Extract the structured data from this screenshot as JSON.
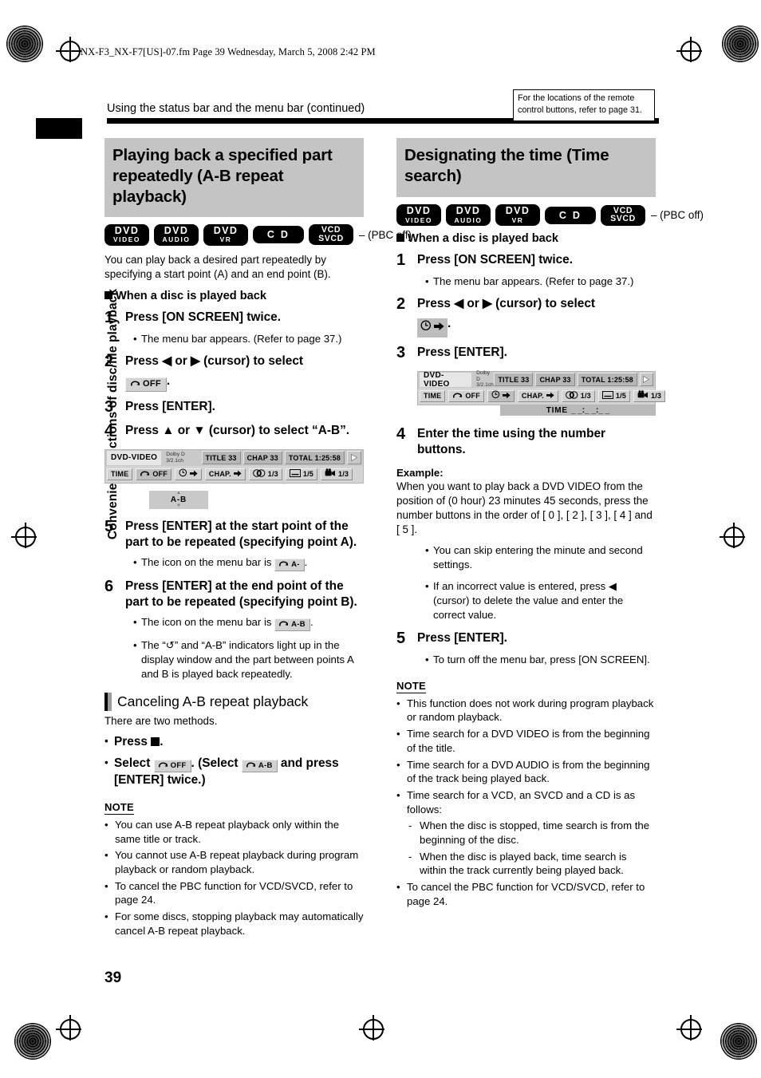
{
  "print_meta": {
    "filename_line": "NX-F3_NX-F7[US]-07.fm  Page 39  Wednesday, March 5, 2008  2:42 PM"
  },
  "side_tab": {
    "label": "Convenient functions of disc/file playback"
  },
  "running_head": {
    "title": "Using the status bar and the menu bar (continued)"
  },
  "remote_note": {
    "text": "For the locations of the remote control buttons, refer to page 31."
  },
  "page_number": "39",
  "disc_badges": [
    {
      "line1": "DVD",
      "line2": "VIDEO"
    },
    {
      "line1": "DVD",
      "line2": "AUDIO"
    },
    {
      "line1": "DVD",
      "line2": "VR"
    },
    {
      "line1": "C D",
      "line2": ""
    },
    {
      "line1": "VCD",
      "line2": "SVCD"
    }
  ],
  "pbc_note": "– (PBC off)",
  "left_column": {
    "title": "Playing back a specified part repeatedly (A-B repeat playback)",
    "intro": "You can play back a desired part repeatedly by specifying a start point (A) and an end point (B).",
    "subhead": "When a disc is played back",
    "steps": [
      {
        "num": "1",
        "text": "Press [ON SCREEN] twice.",
        "subs": [
          "The menu bar appears. (Refer to page 37.)"
        ]
      },
      {
        "num": "2",
        "text_before": "Press ",
        "text_mid": " or ",
        "text_after": " (cursor) to select",
        "chip_label": "OFF",
        "trailing": "."
      },
      {
        "num": "3",
        "text": "Press [ENTER]."
      },
      {
        "num": "4",
        "text": "Press ▲ or ▼ (cursor) to select “A-B”."
      },
      {
        "num": "5",
        "text": "Press [ENTER] at the start point of the part to be repeated (specifying point A).",
        "sub_prefix": "The icon on the menu bar is ",
        "sub_chip": "A-",
        "sub_suffix": "."
      },
      {
        "num": "6",
        "text": "Press [ENTER] at the end point of the part to be repeated (specifying point B).",
        "sub_prefix": "The icon on the menu bar is ",
        "sub_chip": "A-B",
        "sub_suffix": ".",
        "sub2": "The “↺” and “A-B” indicators light up in the display window and the part between points A and B is played back repeatedly."
      }
    ],
    "subsection": {
      "title": "Canceling A-B repeat playback",
      "intro": "There are two methods.",
      "bullet1_before": "Press ",
      "bullet1_after": ".",
      "bullet2_before": "Select ",
      "bullet2_chip1": "OFF",
      "bullet2_mid": ". (Select ",
      "bullet2_chip2": "A-B",
      "bullet2_after": " and press [ENTER] twice.)"
    },
    "note": {
      "heading": "NOTE",
      "items": [
        "You can use A-B repeat playback only within the same title or track.",
        "You cannot use A-B repeat playback during program playback or random playback.",
        "To cancel the PBC function for VCD/SVCD, refer to page 24.",
        "For some discs, stopping playback may automatically cancel A-B repeat playback."
      ]
    },
    "menubar": {
      "disc_label": "DVD-VIDEO",
      "dolby_line1": "Dolby D",
      "dolby_line2": "3/2.1ch",
      "info": [
        "TITLE 33",
        "CHAP 33",
        "TOTAL  1:25:58"
      ],
      "cells": [
        "TIME",
        "OFF",
        "CHAP.",
        "1/3",
        "1/5",
        "1/3"
      ],
      "dropdown": "A-B"
    }
  },
  "right_column": {
    "title": "Designating the time (Time search)",
    "subhead": "When a disc is played back",
    "steps": [
      {
        "num": "1",
        "text": "Press [ON SCREEN] twice.",
        "subs": [
          "The menu bar appears. (Refer to page 37.)"
        ]
      },
      {
        "num": "2",
        "text_before": "Press ",
        "text_mid": " or ",
        "text_after": " (cursor) to select",
        "trailing": "."
      },
      {
        "num": "3",
        "text": "Press [ENTER]."
      },
      {
        "num": "4",
        "text": "Enter the time using the number buttons."
      },
      {
        "num": "5",
        "text": "Press [ENTER].",
        "subs": [
          "To turn off the menu bar, press [ON SCREEN]."
        ]
      }
    ],
    "example": {
      "heading": "Example:",
      "body": "When you want to play back a DVD VIDEO from the position of (0 hour) 23 minutes 45 seconds, press the number buttons in the order of [ 0 ], [ 2 ], [ 3 ], [ 4 ] and [ 5 ].",
      "bullets": [
        "You can skip entering the minute and second settings.",
        "If an incorrect value is entered, press ◀ (cursor) to delete the value and enter the correct value."
      ]
    },
    "note": {
      "heading": "NOTE",
      "items": [
        {
          "text": "This function does not work during program playback or random playback."
        },
        {
          "text": "Time search for a DVD VIDEO is from the beginning of the title."
        },
        {
          "text": "Time search for a DVD AUDIO is from the beginning of the track being played back."
        },
        {
          "text": "Time search for a VCD, an SVCD and a CD is as follows:"
        }
      ],
      "sub_items": [
        "When the disc is stopped, time search is from the beginning of the disc.",
        "When the disc is played back, time search is within the track currently being played back."
      ],
      "last_item": "To cancel the PBC function for VCD/SVCD, refer to page 24."
    },
    "menubar": {
      "disc_label": "DVD-VIDEO",
      "dolby_line1": "Dolby D",
      "dolby_line2": "3/2.1ch",
      "info": [
        "TITLE 33",
        "CHAP 33",
        "TOTAL  1:25:58"
      ],
      "cells": [
        "TIME",
        "OFF",
        "CHAP.",
        "1/3",
        "1/5",
        "1/3"
      ],
      "dropdown_label": "TIME",
      "dropdown_value": "_ _:_ _:_ _"
    }
  }
}
